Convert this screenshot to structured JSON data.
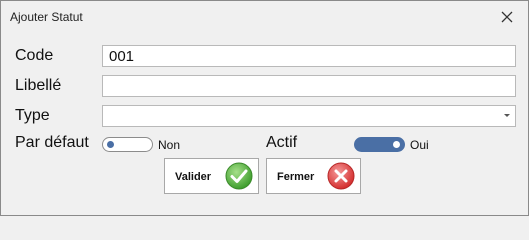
{
  "dialog": {
    "title": "Ajouter Statut",
    "close_glyph": "×"
  },
  "form": {
    "code": {
      "label": "Code",
      "value": "001"
    },
    "libelle": {
      "label": "Libellé",
      "value": ""
    },
    "type": {
      "label": "Type",
      "value": ""
    },
    "par_defaut": {
      "label": "Par défaut",
      "state_text": "Non",
      "checked": false
    },
    "actif": {
      "label": "Actif",
      "state_text": "Oui",
      "checked": true
    }
  },
  "buttons": {
    "valider": {
      "label": "Valider",
      "icon": "check-circle-icon",
      "color": "#5cb85c"
    },
    "fermer": {
      "label": "Fermer",
      "icon": "x-circle-icon",
      "color": "#e74c4c"
    }
  },
  "colors": {
    "toggle_accent": "#4a6fa5"
  }
}
